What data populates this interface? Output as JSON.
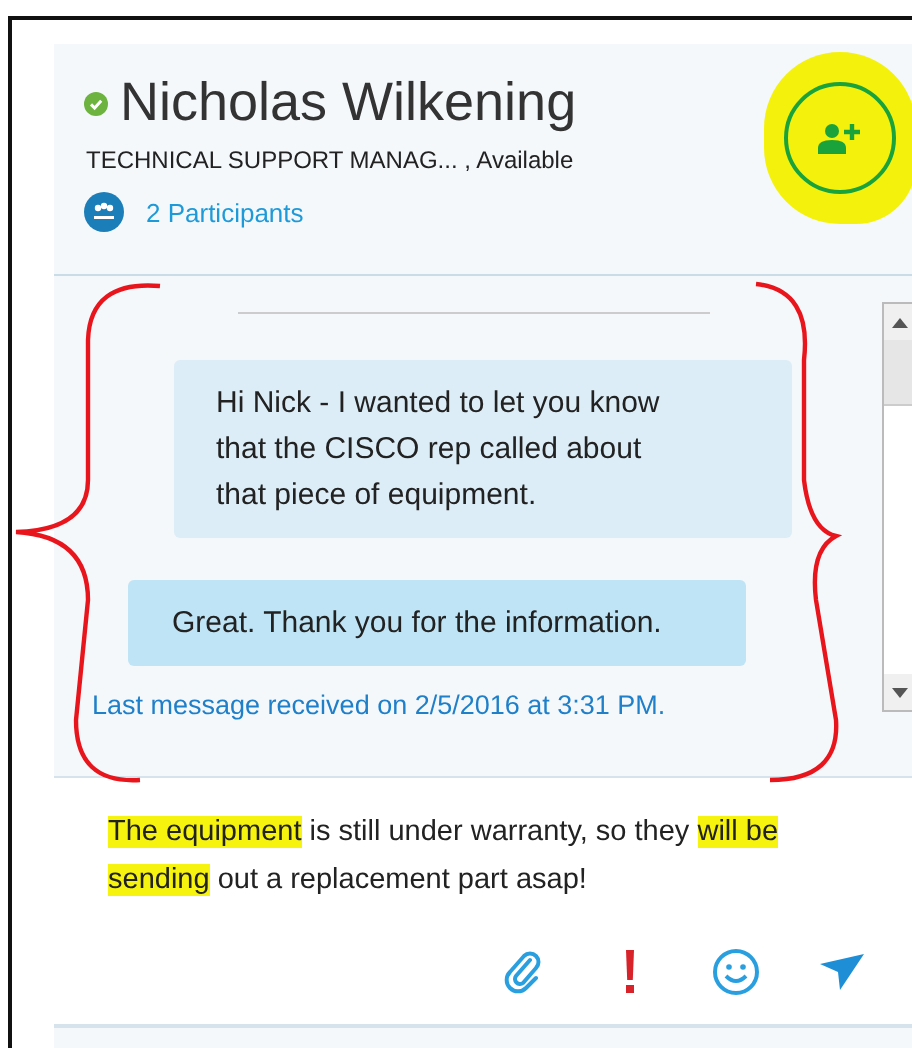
{
  "contact": {
    "name": "Nicholas Wilkening",
    "online": true,
    "subtitle": "TECHNICAL SUPPORT MANAG... ,  Available",
    "participants": "2 Participants"
  },
  "messages": [
    {
      "text": "Hi Nick - I wanted to let you know that the CISCO rep called about that piece of equipment.",
      "outgoing": true
    },
    {
      "text": "Great.  Thank you for the information.",
      "outgoing": false
    }
  ],
  "last_message": "Last message received on 2/5/2016 at 3:31 PM.",
  "compose": [
    {
      "text": "The equipment",
      "highlighted": true
    },
    {
      "text": " is still under warranty, so they ",
      "highlighted": false
    },
    {
      "text": "will be sending",
      "highlighted": true
    },
    {
      "text": " out a replacement part asap!",
      "highlighted": false
    }
  ]
}
